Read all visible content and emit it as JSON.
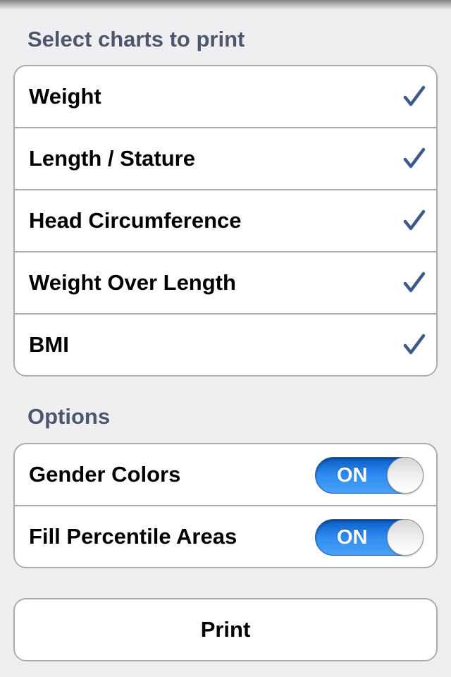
{
  "charts_section": {
    "header": "Select charts to print",
    "items": [
      {
        "label": "Weight",
        "checked": true
      },
      {
        "label": "Length / Stature",
        "checked": true
      },
      {
        "label": "Head Circumference",
        "checked": true
      },
      {
        "label": "Weight Over Length",
        "checked": true
      },
      {
        "label": "BMI",
        "checked": true
      }
    ]
  },
  "options_section": {
    "header": "Options",
    "items": [
      {
        "label": "Gender Colors",
        "toggle_text": "ON",
        "on": true
      },
      {
        "label": "Fill Percentile Areas",
        "toggle_text": "ON",
        "on": true
      }
    ]
  },
  "print_button": {
    "label": "Print"
  },
  "colors": {
    "accent": "#3b5998",
    "checkmark": "#3d5a8c",
    "header_text": "#4c566c",
    "toggle_on": "#2f8cf0"
  },
  "icons": {
    "checkmark": "checkmark-icon"
  }
}
